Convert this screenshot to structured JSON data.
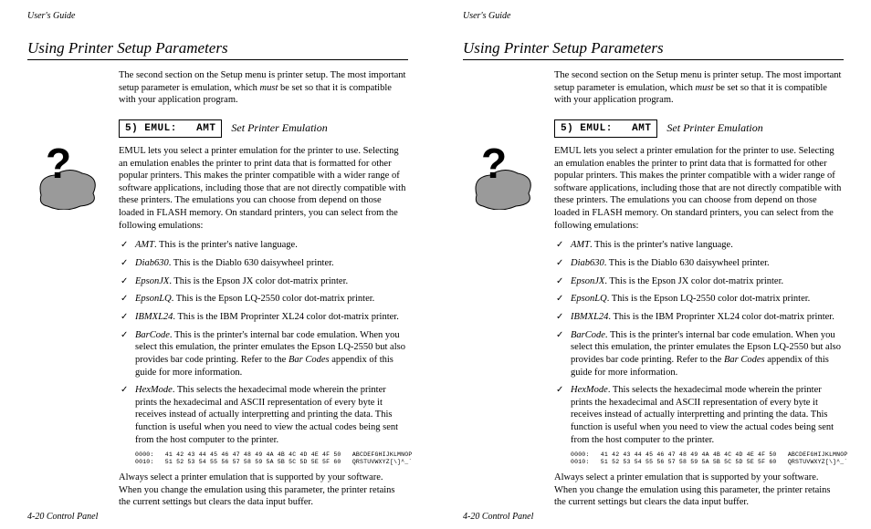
{
  "running_head": "User's Guide",
  "section_title": "Using Printer Setup Parameters",
  "intro_a": "The second section on the Setup menu is printer setup.  The most important setup parameter is emulation, which ",
  "intro_must": "must",
  "intro_b": " be set so that it is compatible with your application program.",
  "param_box": "5) EMUL:   AMT",
  "param_label": "Set Printer Emulation",
  "desc": "EMUL lets you select a printer emulation for the printer to use.  Selecting an emulation enables the printer to print data that is formatted for other popular printers.  This makes the printer compatible with a wider range of software applications, including those that are not directly compatible with these printers.  The emulations you can choose from depend on those loaded in FLASH memory.  On standard printers, you can select from the following emulations:",
  "items": [
    {
      "name": "AMT",
      "text": ".  This is the printer's native language."
    },
    {
      "name": "Diab630",
      "text": ".  This is the Diablo 630 daisywheel printer."
    },
    {
      "name": "EpsonJX",
      "text": ".  This is the Epson JX color dot-matrix printer."
    },
    {
      "name": "EpsonLQ",
      "text": ".  This is the Epson LQ-2550 color dot-matrix printer."
    },
    {
      "name": "IBMXL24",
      "text": ".  This is the IBM Proprinter XL24 color dot-matrix printer."
    },
    {
      "name": "BarCode",
      "text_a": ".  This is the printer's internal bar code emulation.  When you select this emulation, the printer emulates the Epson LQ-2550 but also provides bar code printing.  Refer to the ",
      "text_em": "Bar Codes",
      "text_b": " appendix of this guide for more information."
    },
    {
      "name": "HexMode",
      "text": ".  This selects the hexadecimal mode wherein the printer prints the hexadecimal and ASCII representation of every byte it receives instead of actually interpretting and printing the data.  This function is useful when you need to view the actual codes being sent from the host computer to the printer."
    }
  ],
  "hex_line1": "0000:   41 42 43 44 45 46 47 48 49 4A 4B 4C 4D 4E 4F 50   ABCDEFGHIJKLMNOP",
  "hex_line2": "0010:   51 52 53 54 55 56 57 58 59 5A 5B 5C 5D 5E 5F 60   QRSTUVWXYZ[\\]^_`",
  "closing": "Always select a printer emulation that is supported by your software.  When you change the emulation using this parameter, the printer retains the current settings but clears the data input buffer.",
  "footer": "4-20 Control Panel"
}
